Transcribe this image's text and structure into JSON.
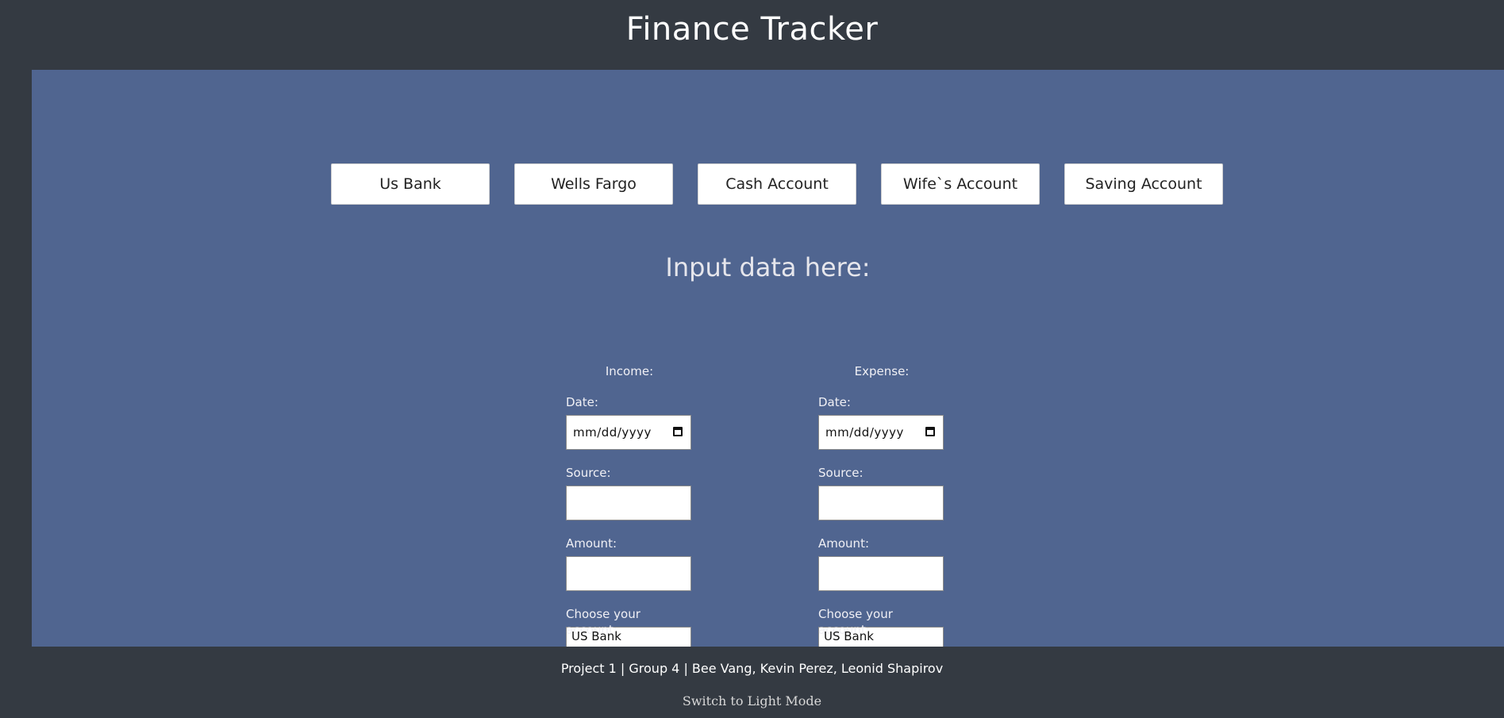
{
  "header": {
    "title": "Finance Tracker"
  },
  "accounts": [
    {
      "label": "Us Bank"
    },
    {
      "label": "Wells Fargo"
    },
    {
      "label": "Cash Account"
    },
    {
      "label": "Wife`s Account"
    },
    {
      "label": "Saving Account"
    }
  ],
  "main": {
    "heading": "Input data here:",
    "income": {
      "title": "Income:",
      "date_label": "Date:",
      "date_value": "mm/dd/yyyy",
      "source_label": "Source:",
      "amount_label": "Amount:",
      "account_label": "Choose your account:",
      "account_value": "US Bank"
    },
    "expense": {
      "title": "Expense:",
      "date_label": "Date:",
      "date_value": "mm/dd/yyyy",
      "source_label": "Source:",
      "amount_label": "Amount:",
      "account_label": "Choose your account:",
      "account_value": "US Bank"
    }
  },
  "footer": {
    "credits": "Project 1 | Group 4 | Bee Vang, Kevin Perez, Leonid Shapirov",
    "mode_toggle": "Switch to Light Mode"
  },
  "colors": {
    "background": "#343a42",
    "panel": "#506590",
    "button": "#ffffff"
  }
}
